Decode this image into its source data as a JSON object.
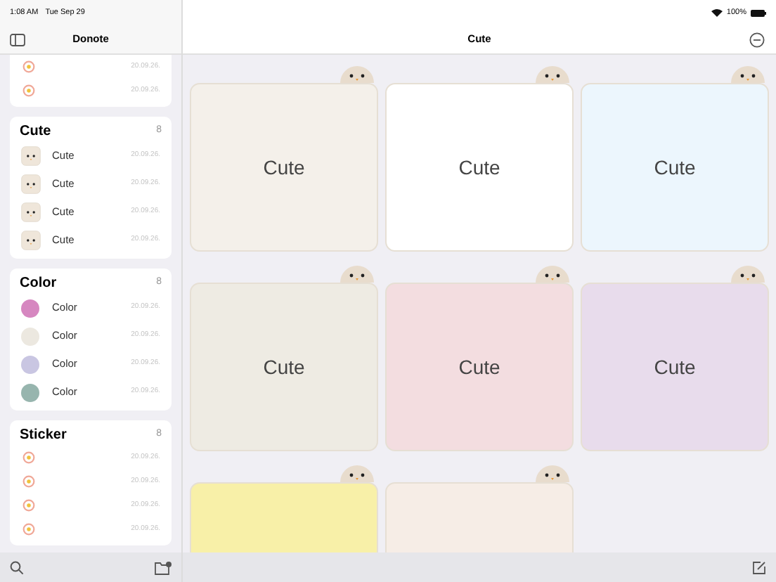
{
  "status_bar": {
    "time": "1:08 AM",
    "date": "Tue Sep 29",
    "battery": "100%"
  },
  "sidebar": {
    "title": "Donote",
    "sections": [
      {
        "items": [
          {
            "kind": "sticker",
            "date": "20.09.26."
          },
          {
            "kind": "sticker",
            "date": "20.09.26."
          }
        ]
      },
      {
        "title": "Cute",
        "count": "8",
        "items": [
          {
            "kind": "animal",
            "label": "Cute",
            "date": "20.09.26."
          },
          {
            "kind": "animal",
            "label": "Cute",
            "date": "20.09.26."
          },
          {
            "kind": "animal",
            "label": "Cute",
            "date": "20.09.26."
          },
          {
            "kind": "animal",
            "label": "Cute",
            "date": "20.09.26."
          }
        ]
      },
      {
        "title": "Color",
        "count": "8",
        "items": [
          {
            "kind": "swatch",
            "label": "Color",
            "color": "#d687c0",
            "date": "20.09.26."
          },
          {
            "kind": "swatch",
            "label": "Color",
            "color": "#ece8e0",
            "date": "20.09.26."
          },
          {
            "kind": "swatch",
            "label": "Color",
            "color": "#c9c6e2",
            "date": "20.09.26."
          },
          {
            "kind": "swatch",
            "label": "Color",
            "color": "#97b5ae",
            "date": "20.09.26."
          }
        ]
      },
      {
        "title": "Sticker",
        "count": "8",
        "items": [
          {
            "kind": "sticker",
            "date": "20.09.26."
          },
          {
            "kind": "sticker",
            "date": "20.09.26."
          },
          {
            "kind": "sticker",
            "date": "20.09.26."
          },
          {
            "kind": "sticker",
            "date": "20.09.26."
          }
        ]
      }
    ]
  },
  "main": {
    "title": "Cute",
    "cards": [
      {
        "label": "Cute",
        "color": "#f4f0ea"
      },
      {
        "label": "Cute",
        "color": "#ffffff"
      },
      {
        "label": "Cute",
        "color": "#ecf6fd"
      },
      {
        "label": "Cute",
        "color": "#eeebe3"
      },
      {
        "label": "Cute",
        "color": "#f3dde0"
      },
      {
        "label": "Cute",
        "color": "#e8dcec"
      },
      {
        "color": "#f8f0a8"
      },
      {
        "color": "#f6ede6"
      }
    ]
  }
}
